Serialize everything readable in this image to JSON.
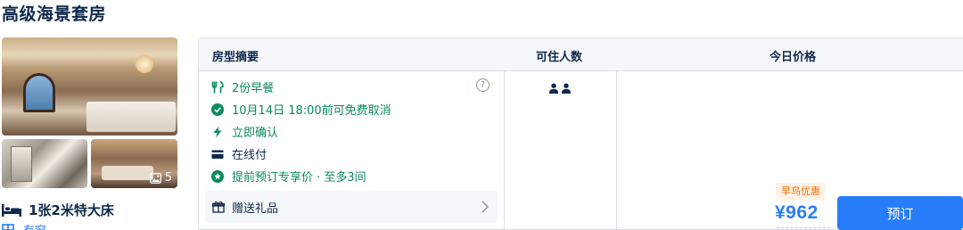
{
  "room": {
    "title": "高级海景套房",
    "photo_count": "5",
    "bed": "1张2米特大床",
    "window": "有窗"
  },
  "table": {
    "headers": {
      "summary": "房型摘要",
      "occupancy": "可住人数",
      "price": "今日价格"
    },
    "features": [
      {
        "icon": "utensils-icon",
        "text": "2份早餐"
      },
      {
        "icon": "check-circle-icon",
        "text": "10月14日 18:00前可免费取消"
      },
      {
        "icon": "lightning-icon",
        "text": "立即确认"
      },
      {
        "icon": "credit-card-icon",
        "text": "在线付"
      },
      {
        "icon": "star-badge-icon",
        "text": "提前预订专享价 · 至多3间"
      }
    ],
    "gift": "赠送礼品",
    "occupancy_count": 2,
    "promo_tag": "早鸟优惠",
    "price": "¥962",
    "book_label": "预订"
  },
  "colors": {
    "accent": "#287dfa",
    "green": "#0b8a5e",
    "promo": "#ff6f00",
    "text": "#0f294d"
  }
}
